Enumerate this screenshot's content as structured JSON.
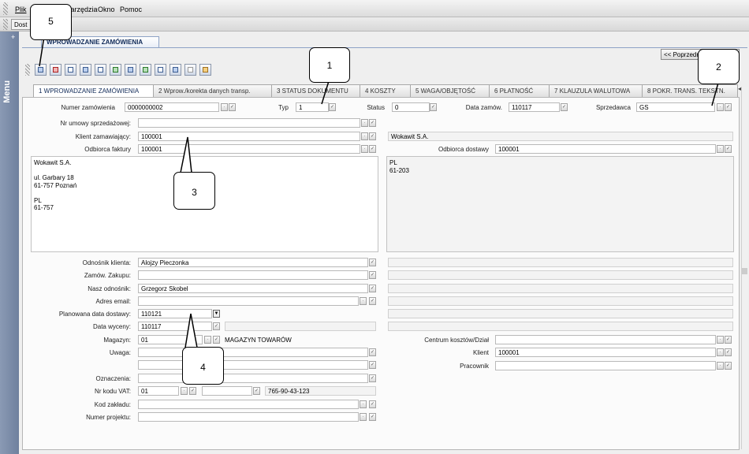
{
  "menu": {
    "items": [
      "Plik",
      "Narzędzia",
      "Okno",
      "Pomoc"
    ]
  },
  "toolbar": {
    "dost_label": "Dost"
  },
  "sidebar": {
    "label": "Menu",
    "plus": "+"
  },
  "header": {
    "title": "WPROWADZANIE ZAMÓWIENIA",
    "prev_button": "<< Poprzedni"
  },
  "tabs": [
    "1 WPROWADZANIE ZAMÓWIENIA",
    "2 Wprow./korekta danych transp.",
    "3 STATUS DOKUMENTU",
    "4 KOSZTY",
    "5 WAGA/OBJĘTOŚĆ",
    "6 PŁATNOŚĆ",
    "7 KLAUZULA WALUTOWA",
    "8 POKR. TRANS. TEKSTN."
  ],
  "form": {
    "numer_label": "Numer zamówienia",
    "numer_value": "0000000002",
    "typ_label": "Typ",
    "typ_value": "1",
    "status_label": "Status",
    "status_value": "0",
    "data_label": "Data zamów.",
    "data_value": "110117",
    "sprzedawca_label": "Sprzedawca",
    "sprzedawca_value": "GS",
    "nr_umowy_label": "Nr umowy sprzedażowej:",
    "nr_umowy_value": "",
    "klient_label": "Klient zamawiający:",
    "klient_value": "100001",
    "klient_name": "Wokawit S.A.",
    "odbiorca_faktury_label": "Odbiorca faktury",
    "odbiorca_faktury_value": "100001",
    "odbiorca_dostawy_label": "Odbiorca dostawy",
    "odbiorca_dostawy_value": "100001",
    "address_left": "Wokawit S.A.\n\nul. Garbary 18\n61-757 Poznań\n\nPL\n61-757",
    "address_right": "PL\n61-203",
    "odnosnik_klienta_label": "Odnośnik klienta:",
    "odnosnik_klienta_value": "Alojzy Pieczonka",
    "zamow_zakupu_label": "Zamów. Zakupu:",
    "zamow_zakupu_value": "",
    "nasz_odnosnik_label": "Nasz odnośnik:",
    "nasz_odnosnik_value": "Grzegorz Skobel",
    "adres_email_label": "Adres email:",
    "adres_email_value": "",
    "planowana_label": "Planowana data dostawy:",
    "planowana_value": "110121",
    "data_wyceny_label": "Data wyceny:",
    "data_wyceny_value": "110117",
    "magazyn_label": "Magazyn:",
    "magazyn_value": "01",
    "magazyn_name": "MAGAZYN TOWARÓW",
    "centrum_label": "Centrum kosztów/Dział",
    "centrum_value": "",
    "uwaga_label": "Uwaga:",
    "uwaga_value": "",
    "klient2_label": "Klient",
    "klient2_value": "100001",
    "pracownik_label": "Pracownik",
    "pracownik_value": "",
    "oznaczenia_label": "Oznaczenia:",
    "oznaczenia_value": "",
    "vat_label": "Nr kodu VAT:",
    "vat_value": "01",
    "vat_number": "765-90-43-123",
    "kod_zakladu_label": "Kod zakładu:",
    "kod_zakladu_value": "",
    "numer_projektu_label": "Numer projektu:",
    "numer_projektu_value": ""
  },
  "callouts": [
    "1",
    "2",
    "3",
    "4",
    "5"
  ]
}
